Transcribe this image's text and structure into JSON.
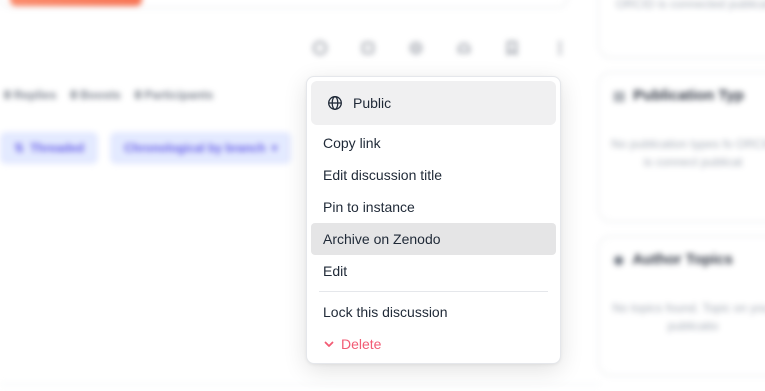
{
  "background": {
    "action_icons": [
      "comment-icon",
      "boost-icon",
      "quote-icon",
      "bookmark-alt-icon",
      "bookmark-icon",
      "more-icon"
    ],
    "stats": [
      {
        "count": "0",
        "label": "Replies"
      },
      {
        "count": "0",
        "label": "Boosts"
      },
      {
        "count": "0",
        "label": "Participants"
      }
    ],
    "view_tabs": {
      "threaded": "Threaded",
      "chronological": "Chronological by branch"
    },
    "sidebar": {
      "top_card_text": "ORCID is connected publicat",
      "publication_types": {
        "title": "Publication Typ",
        "body": "No publication types fo ORCID is connect publicat"
      },
      "author_topics": {
        "title": "Author Topics",
        "body": "No topics found. Topic on your publicatio"
      }
    }
  },
  "menu": {
    "visibility": "Public",
    "items": [
      "Copy link",
      "Edit discussion title",
      "Pin to instance",
      "Archive on Zenodo",
      "Edit"
    ],
    "lock": "Lock this discussion",
    "delete": "Delete",
    "colors": {
      "delete": "#f25b74",
      "highlight": "#e5e5e6"
    }
  }
}
